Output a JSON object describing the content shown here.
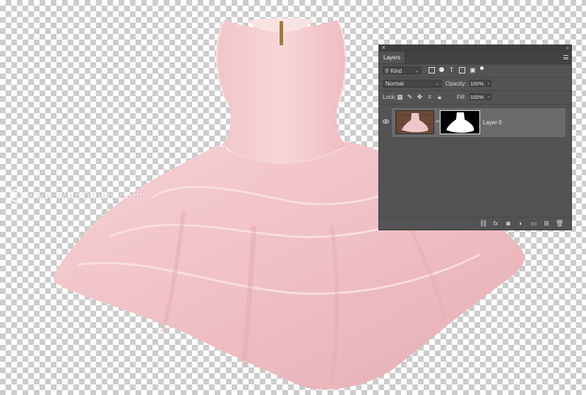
{
  "watermark": {
    "text": "www.MacDown.com"
  },
  "layers_panel": {
    "tab_label": "Layers",
    "filter": {
      "kind_label": "Kind"
    },
    "blend_mode": "Normal",
    "opacity_label": "Opacity:",
    "opacity_value": "100%",
    "lock_label": "Lock:",
    "fill_label": "Fill:",
    "fill_value": "100%",
    "layers": [
      {
        "name": "Layer 0"
      }
    ]
  },
  "colors": {
    "panel_bg": "#535353",
    "selected_row": "#6a6a6a",
    "dress_pink": "#f1c6cb"
  },
  "icons": {
    "filter": [
      "pixel-filter-icon",
      "adjustment-filter-icon",
      "type-filter-icon",
      "shape-filter-icon",
      "smart-object-filter-icon",
      "filter-toggle-icon"
    ],
    "lock": [
      "lock-transparent-pixels-icon",
      "lock-image-pixels-icon",
      "lock-position-icon",
      "lock-artboard-icon",
      "lock-all-icon"
    ],
    "footer": [
      "link-layers-icon",
      "fx-icon",
      "add-mask-icon",
      "new-adjustment-icon",
      "new-group-icon",
      "new-layer-icon",
      "delete-layer-icon"
    ]
  }
}
